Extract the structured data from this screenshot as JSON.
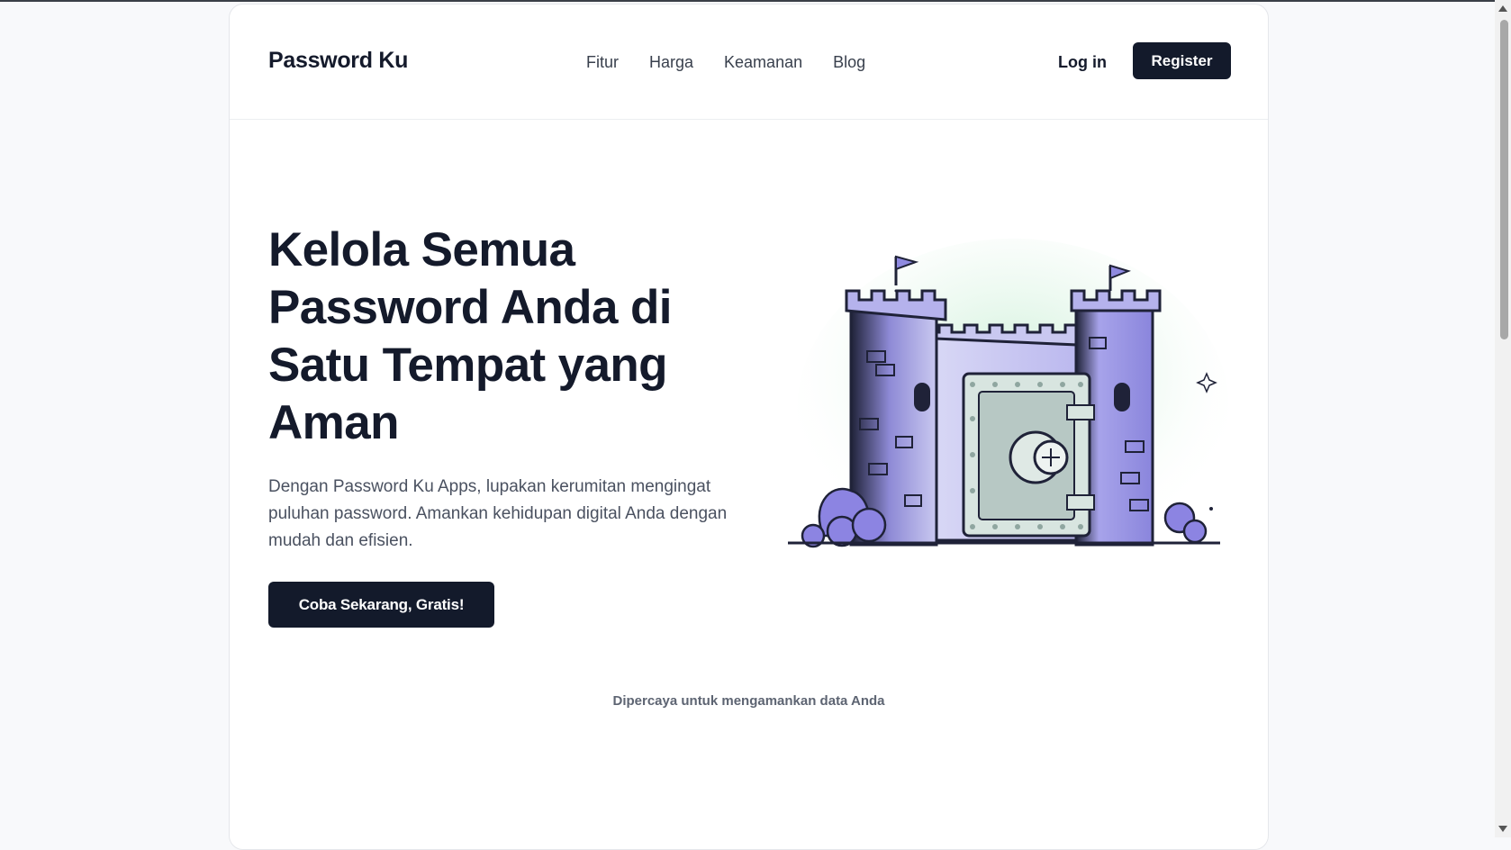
{
  "nav": {
    "brand": "Password Ku",
    "links": [
      "Fitur",
      "Harga",
      "Keamanan",
      "Blog"
    ],
    "login_label": "Log in",
    "register_label": "Register"
  },
  "hero": {
    "title": "Kelola Semua Password Anda di Satu Tempat yang Aman",
    "description": "Dengan Password Ku Apps, lupakan kerumitan mengingat puluhan password. Amankan kehidupan digital Anda dengan mudah dan efisien.",
    "cta_label": "Coba Sekarang, Gratis!",
    "illustration": "castle-vault-illustration"
  },
  "trust": {
    "text": "Dipercaya untuk mengamankan data Anda"
  },
  "colors": {
    "primary": "#131a2b",
    "text": "#141a2b",
    "muted": "#4a5160",
    "castle_light": "#c9c8f0",
    "castle_mid": "#9e9ae6",
    "castle_dark": "#1f2238",
    "glow": "#d7f3de"
  }
}
